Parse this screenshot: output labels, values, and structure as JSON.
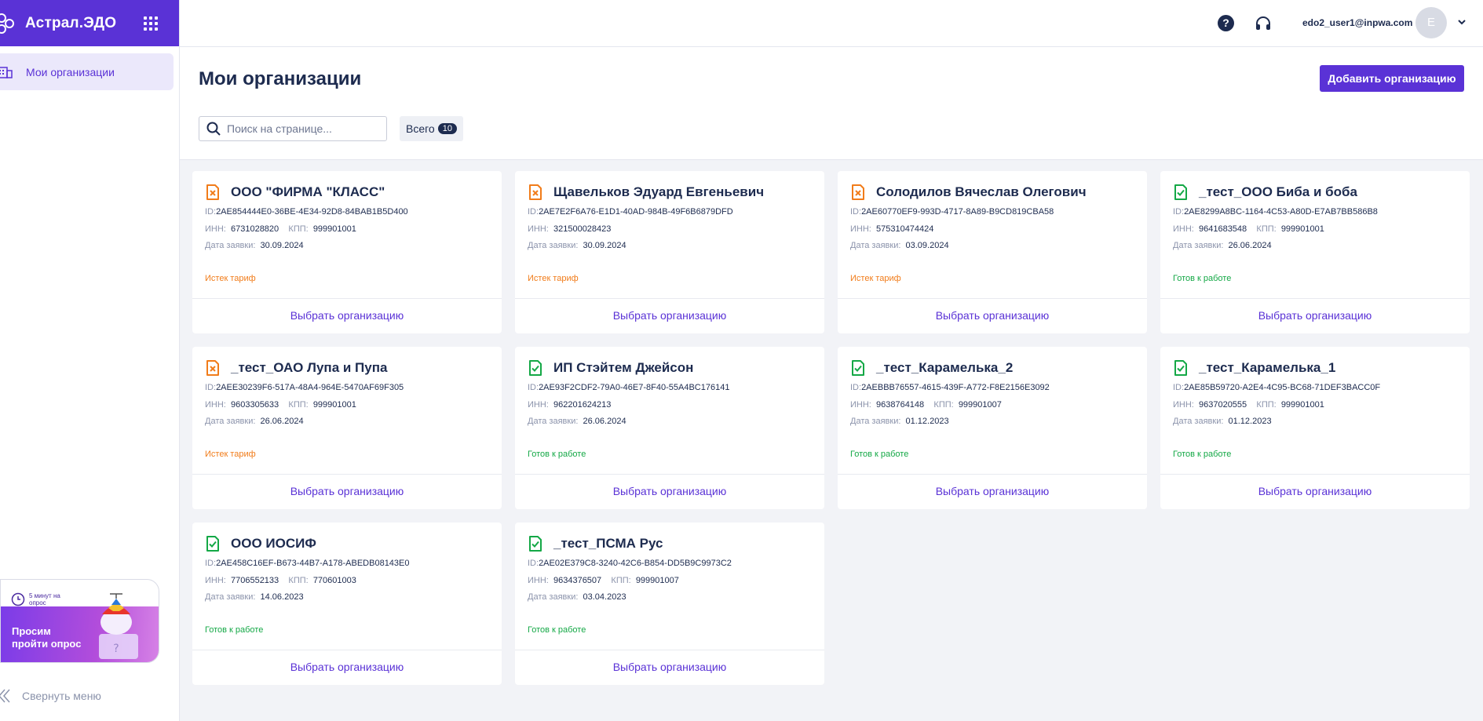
{
  "app": {
    "name": "Астрал.ЭДО"
  },
  "sidebar": {
    "items": [
      {
        "label": "Мои организации"
      }
    ],
    "survey": {
      "timer": "5 минут на опрос",
      "cta": "Просим пройти опрос"
    },
    "collapse_label": "Свернуть меню"
  },
  "topbar": {
    "user_email": "edo2_user1@inpwa.com",
    "avatar_initial": "E"
  },
  "page": {
    "title": "Мои организации",
    "add_button": "Добавить организацию",
    "search_placeholder": "Поиск на странице...",
    "total_label": "Всего",
    "total_count": "10"
  },
  "labels": {
    "id": "ID:",
    "inn": "ИНН:",
    "kpp": "КПП:",
    "date": "Дата заявки:",
    "select": "Выбрать организацию"
  },
  "colors": {
    "accent": "#5a32d6",
    "expired": "#f17c1a",
    "ready": "#14a846"
  },
  "orgs": [
    {
      "name": "ООО \"ФИРМА \"КЛАСС\"",
      "id": "2AE854444E0-36BE-4E34-92D8-84BAB1B5D400",
      "inn": "6731028820",
      "kpp": "999901001",
      "date": "30.09.2024",
      "status": "Истек тариф",
      "state": "expired"
    },
    {
      "name": "Щавельков Эдуард Евгеньевич",
      "id": "2AE7E2F6A76-E1D1-40AD-984B-49F6B6879DFD",
      "inn": "321500028423",
      "kpp": "",
      "date": "30.09.2024",
      "status": "Истек тариф",
      "state": "expired"
    },
    {
      "name": "Солодилов Вячеслав Олегович",
      "id": "2AE60770EF9-993D-4717-8A89-B9CD819CBA58",
      "inn": "575310474424",
      "kpp": "",
      "date": "03.09.2024",
      "status": "Истек тариф",
      "state": "expired"
    },
    {
      "name": "_тест_ООО Биба и боба",
      "id": "2AE8299A8BC-1164-4C53-A80D-E7AB7BB586B8",
      "inn": "9641683548",
      "kpp": "999901001",
      "date": "26.06.2024",
      "status": "Готов к работе",
      "state": "ready"
    },
    {
      "name": "_тест_ОАО Лупа и Пупа",
      "id": "2AEE30239F6-517A-48A4-964E-5470AF69F305",
      "inn": "9603305633",
      "kpp": "999901001",
      "date": "26.06.2024",
      "status": "Истек тариф",
      "state": "expired"
    },
    {
      "name": "ИП Стэйтем Джейсон",
      "id": "2AE93F2CDF2-79A0-46E7-8F40-55A4BC176141",
      "inn": "962201624213",
      "kpp": "",
      "date": "26.06.2024",
      "status": "Готов к работе",
      "state": "ready"
    },
    {
      "name": "_тест_Карамелька_2",
      "id": "2AEBBB76557-4615-439F-A772-F8E2156E3092",
      "inn": "9638764148",
      "kpp": "999901007",
      "date": "01.12.2023",
      "status": "Готов к работе",
      "state": "ready"
    },
    {
      "name": "_тест_Карамелька_1",
      "id": "2AE85B59720-A2E4-4C95-BC68-71DEF3BACC0F",
      "inn": "9637020555",
      "kpp": "999901001",
      "date": "01.12.2023",
      "status": "Готов к работе",
      "state": "ready"
    },
    {
      "name": "ООО ИОСИФ",
      "id": "2AE458C16EF-B673-44B7-A178-ABEDB08143E0",
      "inn": "7706552133",
      "kpp": "770601003",
      "date": "14.06.2023",
      "status": "Готов к работе",
      "state": "ready"
    },
    {
      "name": "_тест_ПСМА Рус",
      "id": "2AE02E379C8-3240-42C6-B854-DD5B9C9973C2",
      "inn": "9634376507",
      "kpp": "999901007",
      "date": "03.04.2023",
      "status": "Готов к работе",
      "state": "ready"
    }
  ]
}
